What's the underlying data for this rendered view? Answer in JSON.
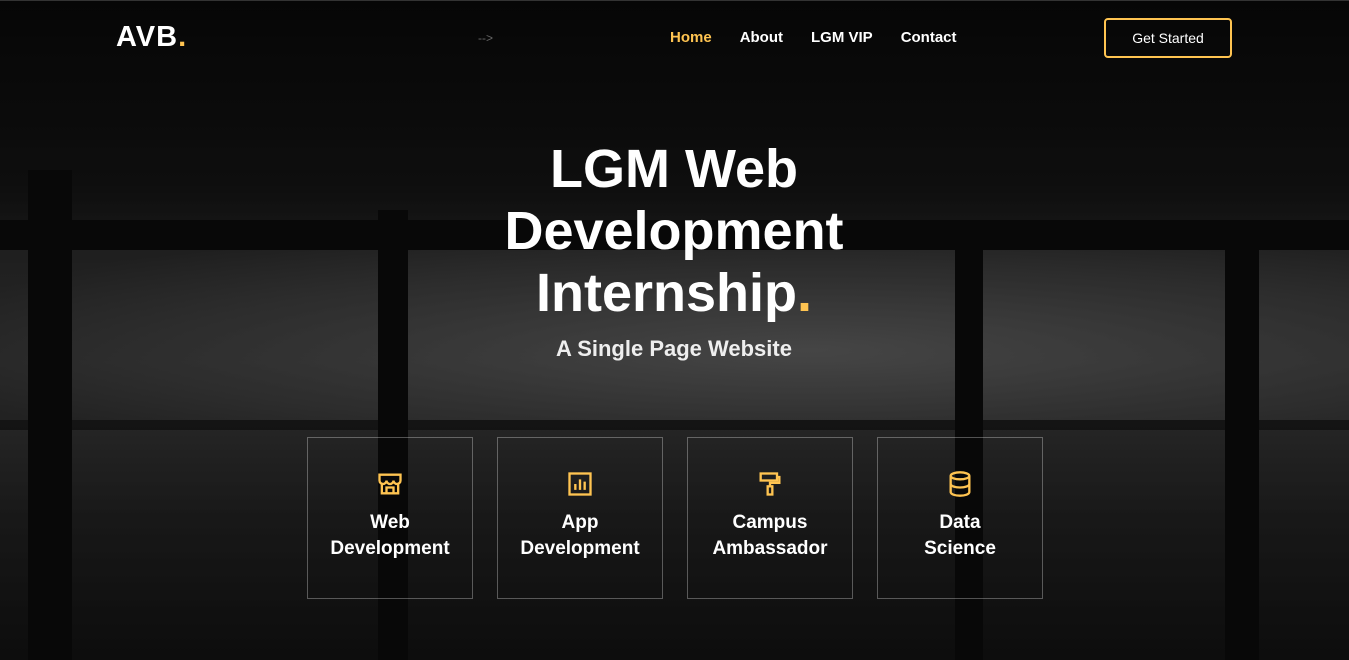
{
  "header": {
    "logo_text": "AVB",
    "logo_dot": ".",
    "comment_text": "-->",
    "nav": [
      {
        "label": "Home",
        "active": true
      },
      {
        "label": "About",
        "active": false
      },
      {
        "label": "LGM VIP",
        "active": false
      },
      {
        "label": "Contact",
        "active": false
      }
    ],
    "cta_label": "Get Started"
  },
  "hero": {
    "title_line1": "LGM Web",
    "title_line2": "Development",
    "title_line3": "Internship",
    "title_dot": ".",
    "subtitle": "A Single Page Website"
  },
  "cards": [
    {
      "label": "Web\nDevelopment",
      "icon": "store-icon"
    },
    {
      "label": "App\nDevelopment",
      "icon": "bar-chart-icon"
    },
    {
      "label": "Campus\nAmbassador",
      "icon": "paint-roller-icon"
    },
    {
      "label": "Data\nScience",
      "icon": "database-icon"
    }
  ],
  "colors": {
    "accent": "#ffc451"
  }
}
